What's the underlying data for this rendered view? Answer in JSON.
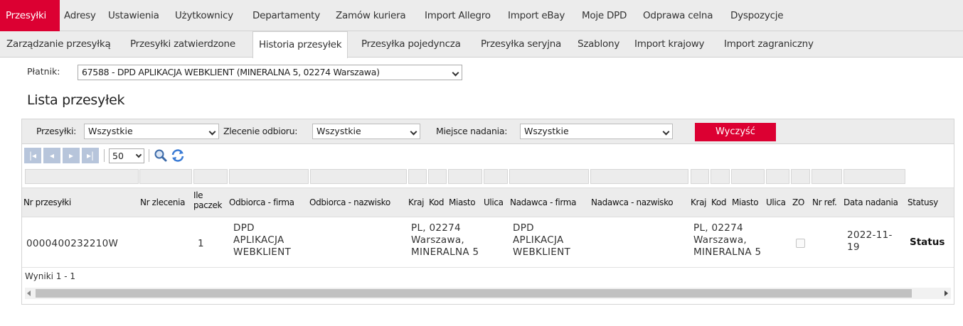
{
  "nav_main": [
    {
      "label": "Przesyłki",
      "active": true
    },
    {
      "label": "Adresy"
    },
    {
      "label": "Ustawienia"
    },
    {
      "label": "Użytkownicy"
    },
    {
      "label": "Departamenty"
    },
    {
      "label": "Zamów kuriera"
    },
    {
      "label": "Import Allegro"
    },
    {
      "label": "Import eBay"
    },
    {
      "label": "Moje DPD"
    },
    {
      "label": "Odprawa celna"
    },
    {
      "label": "Dyspozycje"
    }
  ],
  "nav_sub": [
    {
      "label": "Zarządzanie przesyłką"
    },
    {
      "label": "Przesyłki zatwierdzone"
    },
    {
      "label": "Historia przesyłek",
      "active": true
    },
    {
      "label": "Przesyłka pojedyncza"
    },
    {
      "label": "Przesyłka seryjna"
    },
    {
      "label": "Szablony"
    },
    {
      "label": "Import krajowy"
    },
    {
      "label": "Import zagraniczny"
    }
  ],
  "payer": {
    "label": "Płatnik:",
    "value": "67588 - DPD APLIKACJA WEBKLIENT (MINERALNA 5, 02274 Warszawa)"
  },
  "list_title": "Lista przesyłek",
  "filters": {
    "shipments_label": "Przesyłki:",
    "shipments_value": "Wszystkie",
    "pickup_label": "Zlecenie odbioru:",
    "pickup_value": "Wszystkie",
    "place_label": "Miejsce nadania:",
    "place_value": "Wszystkie",
    "clear_button": "Wyczyść"
  },
  "pager": {
    "page_size": "50"
  },
  "columns": {
    "nr": "Nr przesyłki",
    "nr_zlecenia": "Nr zlecenia",
    "ile_1": "Ile",
    "ile_2": "paczek",
    "odb_firma": "Odbiorca - firma",
    "odb_nazwisko": "Odbiorca - nazwisko",
    "kraj1": "Kraj",
    "kod1": "Kod",
    "miasto1": "Miasto",
    "ulica1": "Ulica",
    "nad_firma": "Nadawca - firma",
    "nad_nazwisko": "Nadawca - nazwisko",
    "kraj2": "Kraj",
    "kod2": "Kod",
    "miasto2": "Miasto",
    "ulica2": "Ulica",
    "zo": "ZO",
    "nr_ref": "Nr ref.",
    "data": "Data nadania",
    "statusy": "Statusy"
  },
  "row": {
    "nr": "0000400232210W",
    "ile": "1",
    "odb_firma": [
      "DPD",
      "APLIKACJA",
      "WEBKLIENT"
    ],
    "odb_adres": [
      "PL, 02274",
      "Warszawa,",
      "MINERALNA 5"
    ],
    "nad_firma": [
      "DPD",
      "APLIKACJA",
      "WEBKLIENT"
    ],
    "nad_adres": [
      "PL, 02274",
      "Warszawa,",
      "MINERALNA 5"
    ],
    "data": [
      "2022-11-",
      "19"
    ],
    "status": "Status"
  },
  "results": "Wyniki 1 - 1"
}
